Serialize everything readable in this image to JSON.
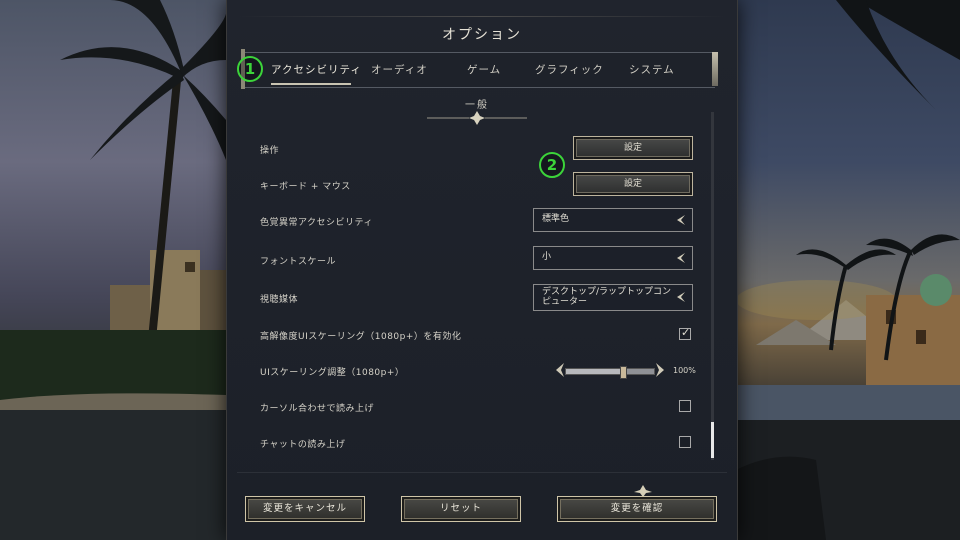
{
  "window": {
    "title": "オプション"
  },
  "tabs": [
    {
      "label": "アクセシビリティ",
      "active": true
    },
    {
      "label": "オーディオ"
    },
    {
      "label": "ゲーム"
    },
    {
      "label": "グラフィック"
    },
    {
      "label": "システム"
    }
  ],
  "annotations": {
    "badge1": "1",
    "badge2": "2"
  },
  "section": {
    "title": "一般"
  },
  "settings": {
    "controls": {
      "label": "操作",
      "button": "設定"
    },
    "keyboard_mouse": {
      "label": "キーボード + マウス",
      "button": "設定"
    },
    "color_blind": {
      "label": "色覚異常アクセシビリティ",
      "value": "標準色"
    },
    "font_scale": {
      "label": "フォントスケール",
      "value": "小"
    },
    "viewing_media": {
      "label": "視聴媒体",
      "value": "デスクトップ/ラップトップコンピューター"
    },
    "hires_ui": {
      "label": "高解像度UIスケーリング（1080p+）を有効化",
      "checked": true
    },
    "ui_scaling": {
      "label": "UIスケーリング調整（1080p+）",
      "value_text": "100%",
      "fraction": 0.65
    },
    "hover_read": {
      "label": "カーソル合わせで読み上げ",
      "checked": false
    },
    "chat_read": {
      "label": "チャットの読み上げ",
      "checked": false
    }
  },
  "footer": {
    "cancel": "変更をキャンセル",
    "reset": "リセット",
    "confirm": "変更を確認"
  },
  "colors": {
    "badge": "#3cd43a",
    "accent_gold": "#c9b99a",
    "panel_bg": "#1e222a"
  }
}
